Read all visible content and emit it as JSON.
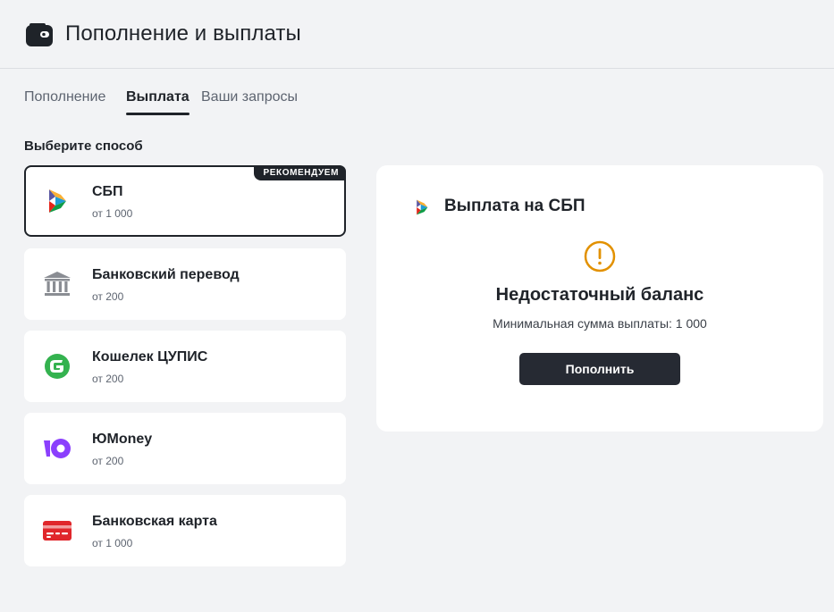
{
  "header": {
    "title": "Пополнение и выплаты",
    "icon": "wallet-icon"
  },
  "tabs": [
    {
      "label": "Пополнение",
      "active": false
    },
    {
      "label": "Выплата",
      "active": true
    },
    {
      "label": "Ваши запросы",
      "active": false
    }
  ],
  "methods_title": "Выберите способ",
  "methods": [
    {
      "name": "СБП",
      "min": "от 1 000",
      "icon": "sbp-icon",
      "selected": true,
      "badge": "РЕКОМЕНДУЕМ"
    },
    {
      "name": "Банковский перевод",
      "min": "от 200",
      "icon": "bank-icon",
      "selected": false
    },
    {
      "name": "Кошелек ЦУПИС",
      "min": "от 200",
      "icon": "cupis-icon",
      "selected": false
    },
    {
      "name": "ЮMoney",
      "min": "от 200",
      "icon": "yoomoney-icon",
      "selected": false
    },
    {
      "name": "Банковская карта",
      "min": "от 1 000",
      "icon": "bank-card-icon",
      "selected": false
    }
  ],
  "panel": {
    "title": "Выплата на СБП",
    "icon": "sbp-icon",
    "warning_icon": "warning-icon",
    "warning_title": "Недостаточный баланс",
    "warning_text": "Минимальная сумма выплаты: 1 000",
    "button_label": "Пополнить"
  },
  "colors": {
    "background": "#f2f3f5",
    "card": "#ffffff",
    "primary_dark": "#262a33",
    "warning": "#e29100",
    "cupis_green": "#34b24f",
    "yoomoney_purple": "#8b3ffd",
    "card_red": "#e0262b"
  }
}
